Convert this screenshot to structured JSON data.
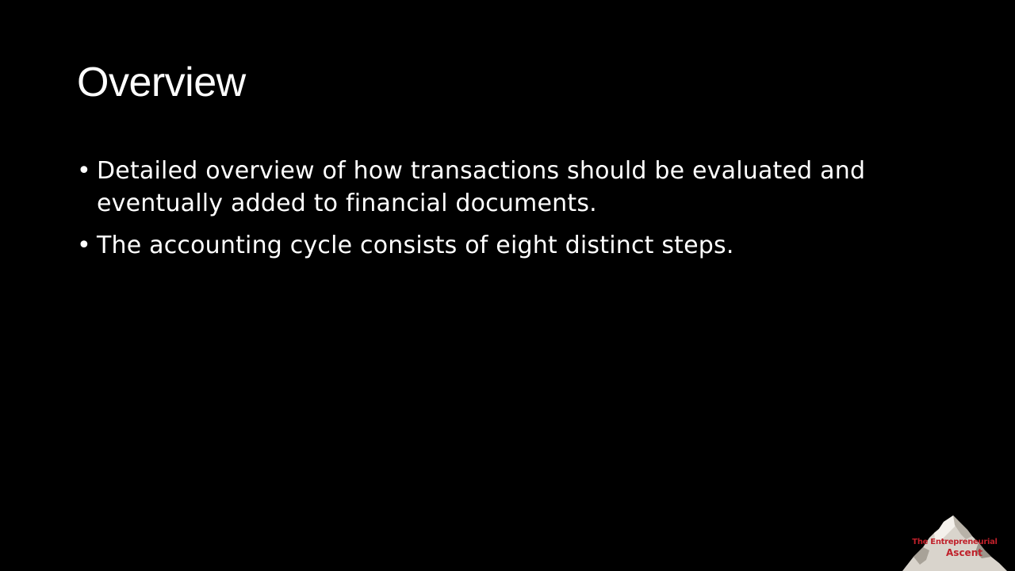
{
  "slide": {
    "title": "Overview",
    "bullets": [
      {
        "marker": "•",
        "text": "Detailed overview of how transactions should be evaluated and eventually added to financial documents."
      },
      {
        "marker": "•",
        "text": "The accounting cycle consists of eight distinct steps."
      }
    ]
  },
  "logo": {
    "line1": "The Entrepreneurial",
    "line2": "Ascent",
    "icon": "mountain-icon",
    "text_color": "#c0202a"
  },
  "colors": {
    "background": "#000000",
    "text": "#ffffff"
  }
}
